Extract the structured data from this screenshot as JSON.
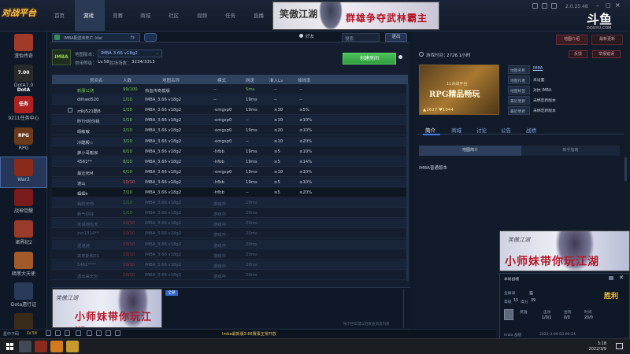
{
  "topbar": {
    "logo": "对战平台",
    "nav": [
      "首页",
      "游戏",
      "竞赛",
      "商城",
      "社区",
      "视频",
      "任务",
      "直播"
    ],
    "active_nav_index": 1,
    "banner_left": "笑傲江湖",
    "banner_right": "群雄争夺武林霸主",
    "version": "2.0.25.48",
    "brand": "斗鱼",
    "brand_sub": "DOUYU.COM"
  },
  "sidebar": {
    "items": [
      {
        "label": "澄怡传奇",
        "icon": "game-icon-legend",
        "color": "#a23a2a"
      },
      {
        "label": "DotA7.0",
        "icon": "game-icon-dota",
        "color": "#2a2a2a",
        "badge": "7.00 DotA"
      },
      {
        "label": "9211任务中心",
        "icon": "game-icon-task",
        "color": "#b02222",
        "badge": "任务"
      },
      {
        "label": "RPG",
        "icon": "game-icon-rpg",
        "color": "#6a3a1a",
        "badge": "RPG"
      },
      {
        "label": "War3",
        "icon": "game-icon-war3",
        "color": "#8a2a1a",
        "active": true
      },
      {
        "label": "战神觉醒",
        "icon": "game-icon-zhanshen",
        "color": "#7a1a1a"
      },
      {
        "label": "诸界纪2",
        "icon": "game-icon-zhujie",
        "color": "#9a3a2a"
      },
      {
        "label": "暗黑大天使",
        "icon": "game-icon-angel",
        "color": "#a25a2a"
      },
      {
        "label": "Dota遗行证",
        "icon": "game-icon-dota-pass",
        "color": "#2a3a5a"
      },
      {
        "label": "DMG",
        "icon": "game-icon-dmg",
        "color": "#3a2a1a"
      }
    ]
  },
  "room": {
    "tab_label": "IMBA配送未死亡 (dei",
    "friends_label": "好友",
    "search_placeholder": "搜索",
    "exit_label": "退出",
    "map_badge": "IMBA",
    "map_version_label": "地图版本：",
    "map_version_value": "IMBA 3.66 v18g2",
    "score_label": "常用等级：",
    "score_value": "Lv.58",
    "games_label": "胜场场数：",
    "games_value": "3234/3315",
    "create_button": "创建房间"
  },
  "table": {
    "headers": [
      "房间名",
      "人数",
      "地图名称",
      "模式",
      "网速",
      "准入Lv",
      "掉线率"
    ],
    "rows": [
      {
        "name": "新服公测",
        "players": "99/100",
        "map": "热血传奇模版",
        "mode": "--",
        "ping": "5ms",
        "lv": "--",
        "drop": "--",
        "highlight": "green"
      },
      {
        "name": "dlihwd520",
        "players": "1/10",
        "map": "IMBA_3.66 v18g2",
        "mode": "--",
        "ping": "19ms",
        "lv": "--",
        "drop": "--"
      },
      {
        "name": "zdkj521酷B",
        "players": "1/10",
        "map": "IMBA_3.66 v18g2",
        "mode": "-omgsp0",
        "ping": "19ms",
        "lv": "≥30",
        "drop": "≤5%",
        "locked": true
      },
      {
        "name": "昨TH时你我",
        "players": "1/10",
        "map": "IMBA_3.66 v18g2",
        "mode": "-omgsp0",
        "ping": "--",
        "lv": "≥10",
        "drop": "≤10%"
      },
      {
        "name": "晴敏敏",
        "players": "2/10",
        "map": "IMBA_3.66 v18g2",
        "mode": "-omgsp0",
        "ping": "19ms",
        "lv": "≥20",
        "drop": "≤10%"
      },
      {
        "name": "冷酷殿☆",
        "players": "3/10",
        "map": "IMBA_3.66 v18g2",
        "mode": "-omgsp0",
        "ping": "--",
        "lv": "≥10",
        "drop": "≤20%"
      },
      {
        "name": "誰小哥搬家",
        "players": "6/10",
        "map": "IMBA_3.66 v18g2",
        "mode": "-hfbb",
        "ping": "19ms",
        "lv": "≥5",
        "drop": "≤10%"
      },
      {
        "name": "4561**",
        "players": "8/10",
        "map": "IMBA_3.66 v18g2",
        "mode": "-hfbb",
        "ping": "19ms",
        "lv": "≥5",
        "drop": "≤14%"
      },
      {
        "name": "最近死M.",
        "players": "6/10",
        "map": "IMBA_3.66 v18g2",
        "mode": "-omgsp0",
        "ping": "19ms",
        "lv": "≥10",
        "drop": "≤10%"
      },
      {
        "name": "道山",
        "players": "10/10",
        "map": "IMBA_3.66 v18g2",
        "mode": "-hfbb",
        "ping": "19ms",
        "lv": "≥5",
        "drop": "≤10%"
      },
      {
        "name": "蝈蝈k",
        "players": "7/10",
        "map": "IMBA_3.66 v18g2",
        "mode": "-hfbb",
        "ping": "--",
        "lv": "≥5",
        "drop": "≤20%",
        "selected": true
      },
      {
        "name": "我的无你",
        "players": "1/10",
        "map": "IMBA_3.66 v18g2",
        "mode": "游戏中",
        "ping": "20ms",
        "lv": "",
        "drop": "",
        "dim": true
      },
      {
        "name": "新气你好",
        "players": "1/10",
        "map": "IMBA_3.66 v18g2",
        "mode": "游戏中",
        "ping": "20ms",
        "lv": "",
        "drop": "",
        "dim": true
      },
      {
        "name": "天说地也天",
        "players": "10/10",
        "map": "IMBA_3.66 v18g2",
        "mode": "游戏中",
        "ping": "20ms",
        "lv": "",
        "drop": "",
        "dim": true
      },
      {
        "name": "zxc1314**",
        "players": "10/10",
        "map": "IMBA_3.66 v18g2",
        "mode": "游戏中",
        "ping": "20ms",
        "lv": "",
        "drop": "",
        "dim": true
      },
      {
        "name": "迷谜谜",
        "players": "10/10",
        "map": "IMBA_3.66 v18g2",
        "mode": "游戏中",
        "ping": "20ms",
        "lv": "",
        "drop": "",
        "dim": true
      },
      {
        "name": "来到斯和01",
        "players": "10/10",
        "map": "IMBA_3.66 v18g2",
        "mode": "游戏中",
        "ping": "20ms",
        "lv": "",
        "drop": "",
        "dim": true
      },
      {
        "name": "5461****",
        "players": "10/10",
        "map": "IMBA_3.66 v18g2",
        "mode": "游戏中",
        "ping": "20ms",
        "lv": "",
        "drop": "",
        "dim": true
      },
      {
        "name": "透出来天空",
        "players": "10/10",
        "map": "IMBA_3.66 v18g2",
        "mode": "游戏中",
        "ping": "20ms",
        "lv": "",
        "drop": "",
        "dim": true
      }
    ]
  },
  "chat": {
    "banner_top": "笑傲江湖",
    "banner_main": "小师妹带你玩江湖",
    "tag": "全部",
    "hint": "按下回车键以后发送消息内容"
  },
  "right_panel": {
    "map_intro_btn": "地图介绍",
    "recent_btn": "最新更新",
    "time_label": "游戏时间：",
    "time_value": "2726.1小时",
    "feedback_btn": "反馈",
    "report_btn": "举报错误",
    "card_sub": "11对战平台",
    "card_title": "RPG精品畅玩",
    "card_likes": "1627",
    "card_hearts": "1044",
    "info": [
      {
        "k": "地图名称",
        "v": "IMBA",
        "link": true
      },
      {
        "k": "地图作者",
        "v": "未设置"
      },
      {
        "k": "地图标签",
        "v": "对抗  IMBA"
      },
      {
        "k": "最近更新",
        "v": "未绑定新版本"
      },
      {
        "k": "最近更新",
        "v": "未绑定新版本"
      }
    ],
    "tabs": [
      "简介",
      "商城",
      "讨论",
      "公告",
      "战绩"
    ],
    "active_tab": 0,
    "subtabs": [
      "地图简介",
      "新手指南"
    ],
    "desc": "IMBA普通版本"
  },
  "overlay": {
    "banner_top": "笑傲江湖",
    "banner_main": "小师妹带你玩江湖",
    "title": "本局战绩",
    "result": "胜利",
    "rows": [
      {
        "k": "全屏录",
        "v": "猫"
      },
      {
        "k": "等级",
        "v": "15"
      },
      {
        "k": "得分",
        "v": "39"
      }
    ],
    "kda_head": [
      "英雄",
      "击杀",
      "金钱",
      "时间"
    ],
    "kda_vals": [
      "1/0/1",
      "0/0",
      "20/0"
    ],
    "footer_left": "Imba 战绩",
    "footer_date": "2022-3-09  03:09:24"
  },
  "status": {
    "user": "星中下码",
    "level": "LV.58",
    "notice": "Imba最新版3.66赛事正常开放"
  },
  "taskbar": {
    "time": "3:18",
    "date": "2022/3/9"
  }
}
